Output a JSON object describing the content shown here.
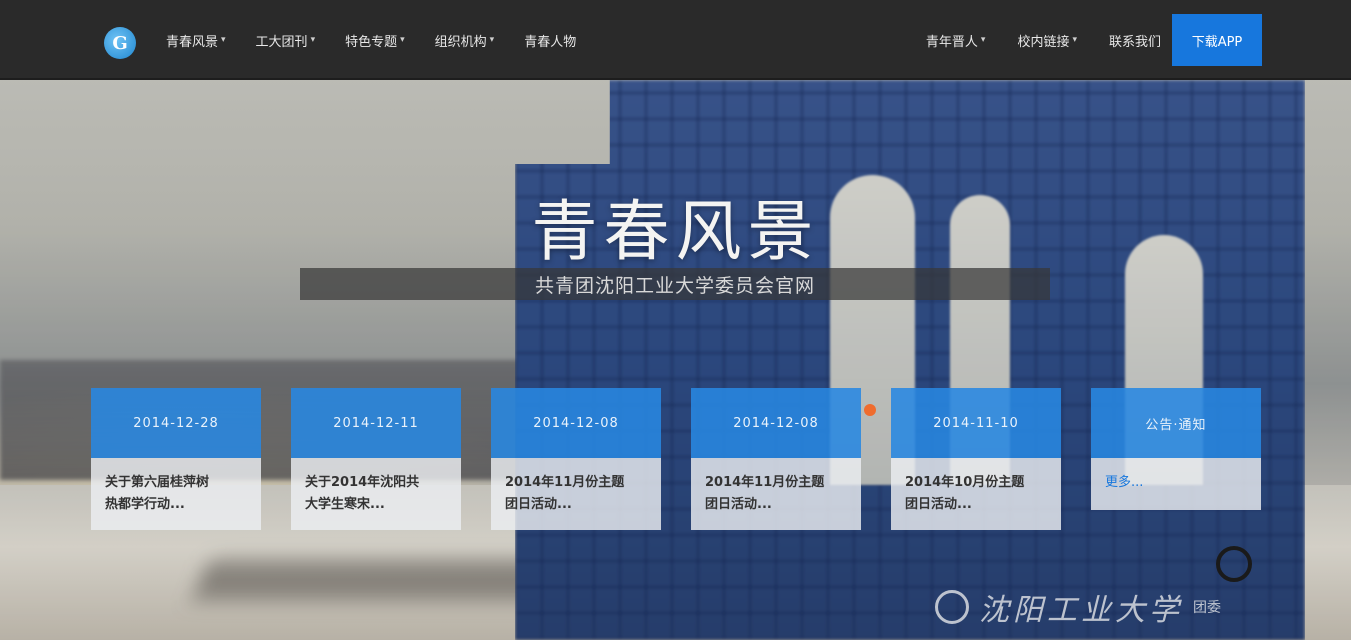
{
  "nav": {
    "logo_text": "G",
    "left_items": [
      {
        "label": "青春风景",
        "dropdown": true
      },
      {
        "label": "工大团刊",
        "dropdown": true
      },
      {
        "label": "特色专题",
        "dropdown": true
      },
      {
        "label": "组织机构",
        "dropdown": true
      },
      {
        "label": "青春人物",
        "dropdown": false
      }
    ],
    "right_items": [
      {
        "label": "青年晋人",
        "dropdown": true
      },
      {
        "label": "校内链接",
        "dropdown": true
      },
      {
        "label": "联系我们",
        "dropdown": false
      }
    ],
    "download_label": "下载APP",
    "caret": "▾"
  },
  "hero": {
    "title": "青春风景",
    "subtitle": "共青团沈阳工业大学委员会官网"
  },
  "cards": [
    {
      "date": "2014-12-28",
      "line1": "关于第六届桂萍树",
      "line2": "热都学行动..."
    },
    {
      "date": "2014-12-11",
      "line1": "关于2014年沈阳共",
      "line2": "大学生寒宋..."
    },
    {
      "date": "2014-12-08",
      "line1": "2014年11月份主题",
      "line2": "团日活动..."
    },
    {
      "date": "2014-12-08",
      "line1": "2014年11月份主题",
      "line2": "团日活动..."
    },
    {
      "date": "2014-11-10",
      "line1": "2014年10月份主题",
      "line2": "团日活动..."
    }
  ],
  "notice": {
    "title": "公告·通知",
    "link": "更多..."
  },
  "watermark": {
    "text": "沈阳工业大学",
    "tail": "团委"
  },
  "colors": {
    "nav_bg": "#2a2a2a",
    "accent_blue": "#1777dd",
    "card_head": "#2887e1"
  }
}
